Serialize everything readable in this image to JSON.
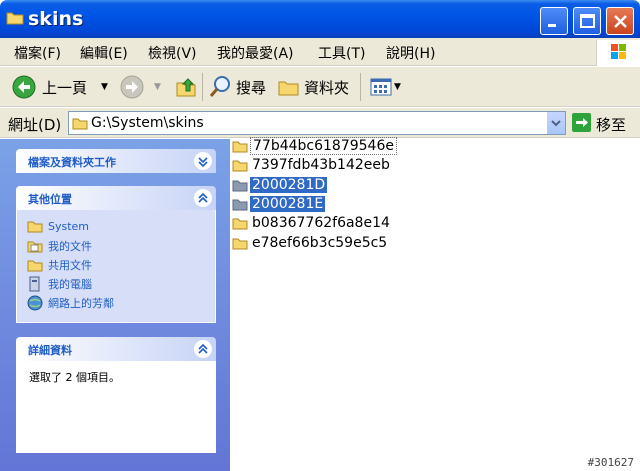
{
  "window": {
    "title": "skins"
  },
  "menu": [
    "檔案(F)",
    "編輯(E)",
    "檢視(V)",
    "我的最愛(A)",
    "工具(T)",
    "說明(H)"
  ],
  "toolbar": {
    "back": "上一頁",
    "search": "搜尋",
    "folders": "資料夾"
  },
  "address": {
    "label": "網址(D)",
    "path": "G:\\System\\skins",
    "go": "移至"
  },
  "taskpane": {
    "file_tasks_title": "檔案及資料夾工作",
    "other_places_title": "其他位置",
    "other_places": [
      "System",
      "我的文件",
      "共用文件",
      "我的電腦",
      "網路上的芳鄰"
    ],
    "details_title": "詳細資料",
    "details_text": "選取了 2 個項目。"
  },
  "files": [
    {
      "name": "77b44bc61879546e",
      "selected": false,
      "focus": true
    },
    {
      "name": "7397fdb43b142eeb",
      "selected": false,
      "focus": false
    },
    {
      "name": "2000281D",
      "selected": true,
      "focus": false
    },
    {
      "name": "2000281E",
      "selected": true,
      "focus": false
    },
    {
      "name": "b08367762f6a8e14",
      "selected": false,
      "focus": false
    },
    {
      "name": "e78ef66b3c59e5c5",
      "selected": false,
      "focus": false
    }
  ],
  "watermark": "#301627",
  "colors": {
    "titlebar": "#0055e5",
    "selection": "#316ac5",
    "pane": "#7ba2e7"
  }
}
